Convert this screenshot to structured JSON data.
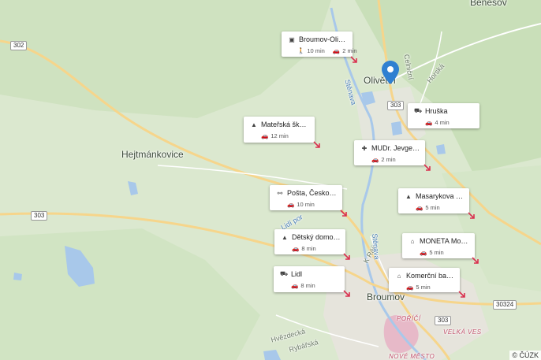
{
  "map": {
    "towns": {
      "benesov": "Benešov",
      "olivetin": "Olivětín",
      "hejtmankovice": "Hejtmánkovice",
      "broumov": "Broumov"
    },
    "streets": {
      "horska": "Horská",
      "celnicni": "Celniční",
      "k_reji": "K Ráji",
      "hvezdecka": "Hvězdecká",
      "rybarska": "Rybářská",
      "lidi_por": "Lidí por"
    },
    "rivers": {
      "stenava1": "Stěnava",
      "stenava2": "Stěnava"
    },
    "districts": {
      "porici": "POŘÍČÍ",
      "velka_ves": "VELKÁ VES",
      "nove_mesto": "NOVÉ MĚSTO"
    },
    "road_shields": {
      "r302": "302",
      "r303a": "303",
      "r303b": "303",
      "r303c": "303",
      "r30324": "30324"
    },
    "colors": {
      "primary_road": "#f6d58b",
      "secondary_road": "#ffffff",
      "water": "#a8c8ea",
      "pin": "#2f80d1",
      "arrow": "#d9304f"
    }
  },
  "cards": [
    {
      "icon": "bus-icon",
      "glyph": "🚌",
      "title": "Broumov-Olivětín",
      "walk": "10 min",
      "drive": "2 min"
    },
    {
      "icon": "shopping-cart-icon",
      "glyph": "🛒",
      "title": "Hruška",
      "drive": "4 min"
    },
    {
      "icon": "school-icon",
      "glyph": "🎓",
      "title": "Mateřská škola H...",
      "drive": "12 min"
    },
    {
      "icon": "medical-icon",
      "glyph": "✚",
      "title": "MUDr. Jevgenjevi...",
      "drive": "2 min"
    },
    {
      "icon": "post-office-icon",
      "glyph": "⚯",
      "title": "Pošta, Československe...",
      "drive": "10 min"
    },
    {
      "icon": "school-icon",
      "glyph": "🎓",
      "title": "Masarykova Zákl...",
      "drive": "5 min"
    },
    {
      "icon": "school-icon",
      "glyph": "🎓",
      "title": "Dětský domov ma...",
      "drive": "8 min"
    },
    {
      "icon": "bank-icon",
      "glyph": "🏛",
      "title": "MONETA Money ...",
      "drive": "5 min"
    },
    {
      "icon": "shopping-cart-icon",
      "glyph": "🛒",
      "title": "Lidl",
      "drive": "8 min"
    },
    {
      "icon": "bank-icon",
      "glyph": "🏛",
      "title": "Komerční banka",
      "drive": "5 min"
    }
  ],
  "attribution": "© ČÚZK"
}
